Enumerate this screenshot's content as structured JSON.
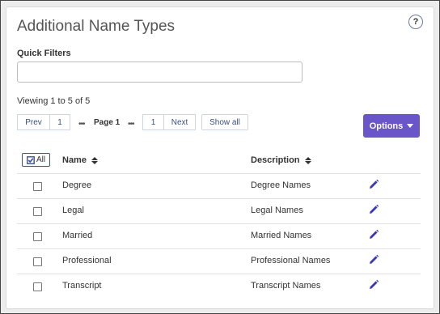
{
  "header": {
    "title": "Additional Name Types",
    "help_label": "?"
  },
  "filters": {
    "label": "Quick Filters",
    "value": "",
    "placeholder": ""
  },
  "viewing": "Viewing 1 to 5 of 5",
  "pager": {
    "prev": "Prev",
    "first_page": "1",
    "dots": "•••",
    "page_label": "Page 1",
    "last_page": "1",
    "next": "Next",
    "show_all": "Show all"
  },
  "options_label": "Options",
  "table": {
    "select_all_label": "All",
    "columns": [
      "Name",
      "Description"
    ],
    "rows": [
      {
        "name": "Degree",
        "description": "Degree Names"
      },
      {
        "name": "Legal",
        "description": "Legal Names"
      },
      {
        "name": "Married",
        "description": "Married Names"
      },
      {
        "name": "Professional",
        "description": "Professional Names"
      },
      {
        "name": "Transcript",
        "description": "Transcript Names"
      }
    ]
  },
  "colors": {
    "accent": "#6a56c9",
    "edit_icon": "#3a3ab5",
    "link": "#3a4f82"
  },
  "icons": {
    "help": "question-icon",
    "edit": "pencil-icon",
    "select_all": "checkbox-icon",
    "sort": "sort-icon",
    "options": "caret-down-icon"
  }
}
